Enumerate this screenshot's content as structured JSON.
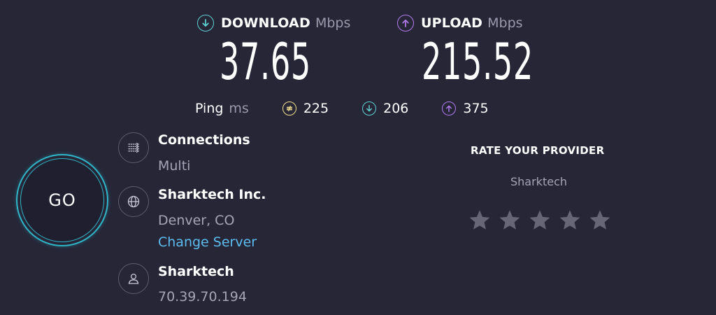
{
  "download": {
    "label": "DOWNLOAD",
    "unit": "Mbps",
    "value": "37.65",
    "icon": "arrow-down-circle-icon",
    "color": "#5fd3d2"
  },
  "upload": {
    "label": "UPLOAD",
    "unit": "Mbps",
    "value": "215.52",
    "icon": "arrow-up-circle-icon",
    "color": "#b27cf0"
  },
  "ping": {
    "label": "Ping",
    "unit": "ms",
    "jitter": {
      "value": "225",
      "icon": "jitter-icon",
      "color": "#f2e08e"
    },
    "download": {
      "value": "206",
      "icon": "arrow-down-circle-icon",
      "color": "#5fd3d2"
    },
    "upload": {
      "value": "375",
      "icon": "arrow-up-circle-icon",
      "color": "#b27cf0"
    }
  },
  "go_button": {
    "label": "GO",
    "color": "#2fb6c8"
  },
  "connections": {
    "title": "Connections",
    "value": "Multi",
    "icon": "connections-icon"
  },
  "server": {
    "title": "Sharktech Inc.",
    "location": "Denver, CO",
    "change_label": "Change Server",
    "icon": "globe-icon",
    "link_color": "#5cbcf0"
  },
  "provider": {
    "title": "Sharktech",
    "ip": "70.39.70.194",
    "icon": "user-icon"
  },
  "rate": {
    "title": "RATE YOUR PROVIDER",
    "provider": "Sharktech",
    "rating": 0,
    "max_rating": 5,
    "star_color": "#666677"
  }
}
